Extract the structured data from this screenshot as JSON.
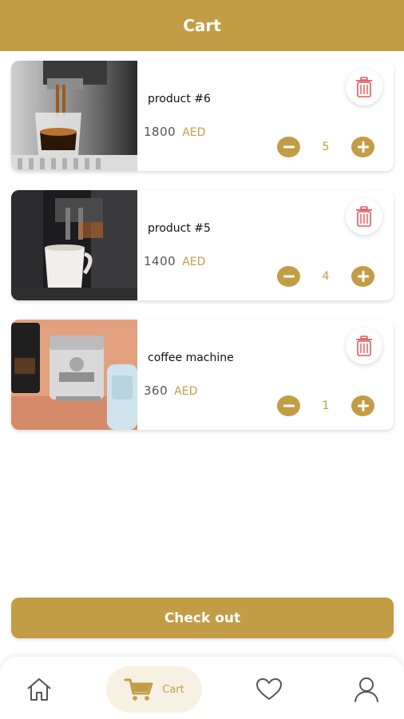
{
  "header": {
    "title": "Cart"
  },
  "cart": {
    "items": [
      {
        "name": "product #6",
        "price": "1800",
        "currency": "AED",
        "quantity": "5",
        "image": "espresso-shot-photo"
      },
      {
        "name": "product #5",
        "price": "1400",
        "currency": "AED",
        "quantity": "4",
        "image": "coffee-cup-machine-photo"
      },
      {
        "name": "coffee machine",
        "price": "360",
        "currency": "AED",
        "quantity": "1",
        "image": "coffee-machines-photo"
      }
    ]
  },
  "checkout": {
    "label": "Check out"
  },
  "nav": {
    "items": [
      {
        "icon": "home-icon"
      },
      {
        "icon": "cart-icon",
        "label": "Cart",
        "active": true
      },
      {
        "icon": "heart-icon"
      },
      {
        "icon": "profile-icon"
      }
    ]
  },
  "colors": {
    "accent": "#c39d45",
    "delete": "#e05a5a",
    "active_nav_bg": "#f7f1e3"
  }
}
